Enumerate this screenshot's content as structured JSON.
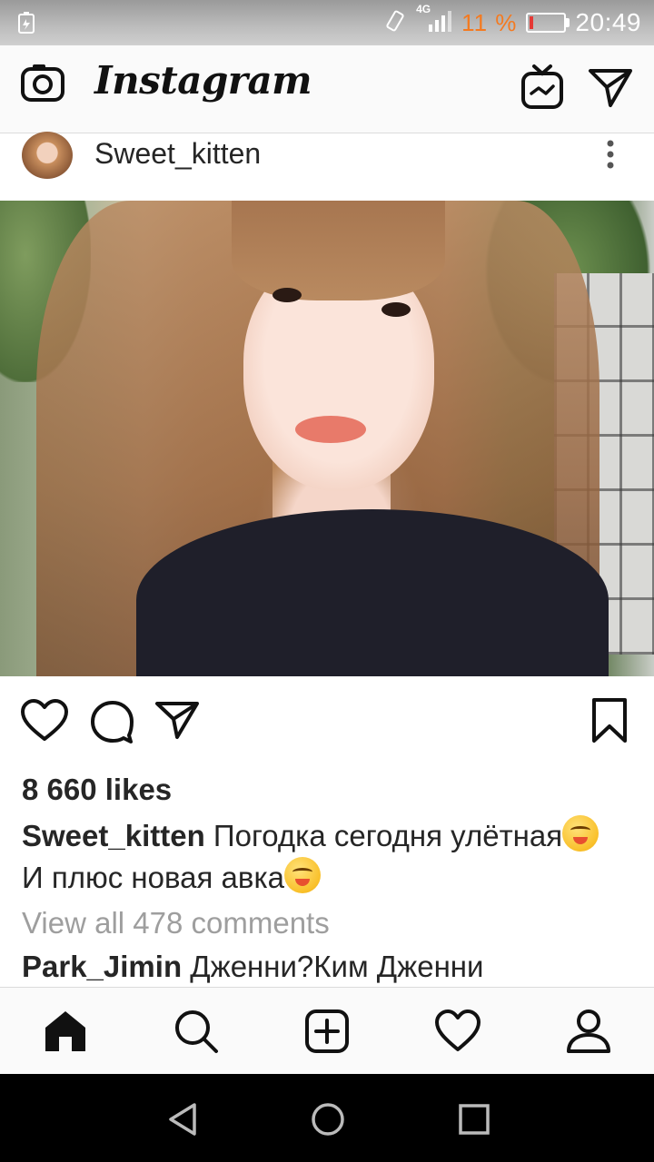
{
  "status_bar": {
    "network": "4G",
    "battery_percent": "11 %",
    "time": "20:49",
    "battery_color": "#f47a20"
  },
  "header": {
    "logo": "Instagram",
    "icons": [
      "camera-icon",
      "igtv-icon",
      "direct-message-icon"
    ]
  },
  "post": {
    "username": "Sweet_kitten",
    "photo_description": "selfie",
    "likes": "8 660 likes",
    "caption_user": "Sweet_kitten",
    "caption_line1": " Погодка сегодня улётная",
    "caption_line2": "И плюс новая авка",
    "view_all_comments": "View all 478 comments",
    "comment_user": "Park_Jimin",
    "comment_text": " Дженни?Ким Дженни"
  },
  "tabs": [
    "home-icon",
    "search-icon",
    "new-post-icon",
    "activity-heart-icon",
    "profile-icon"
  ],
  "nav": [
    "back-icon",
    "home-circle-icon",
    "recents-icon"
  ]
}
